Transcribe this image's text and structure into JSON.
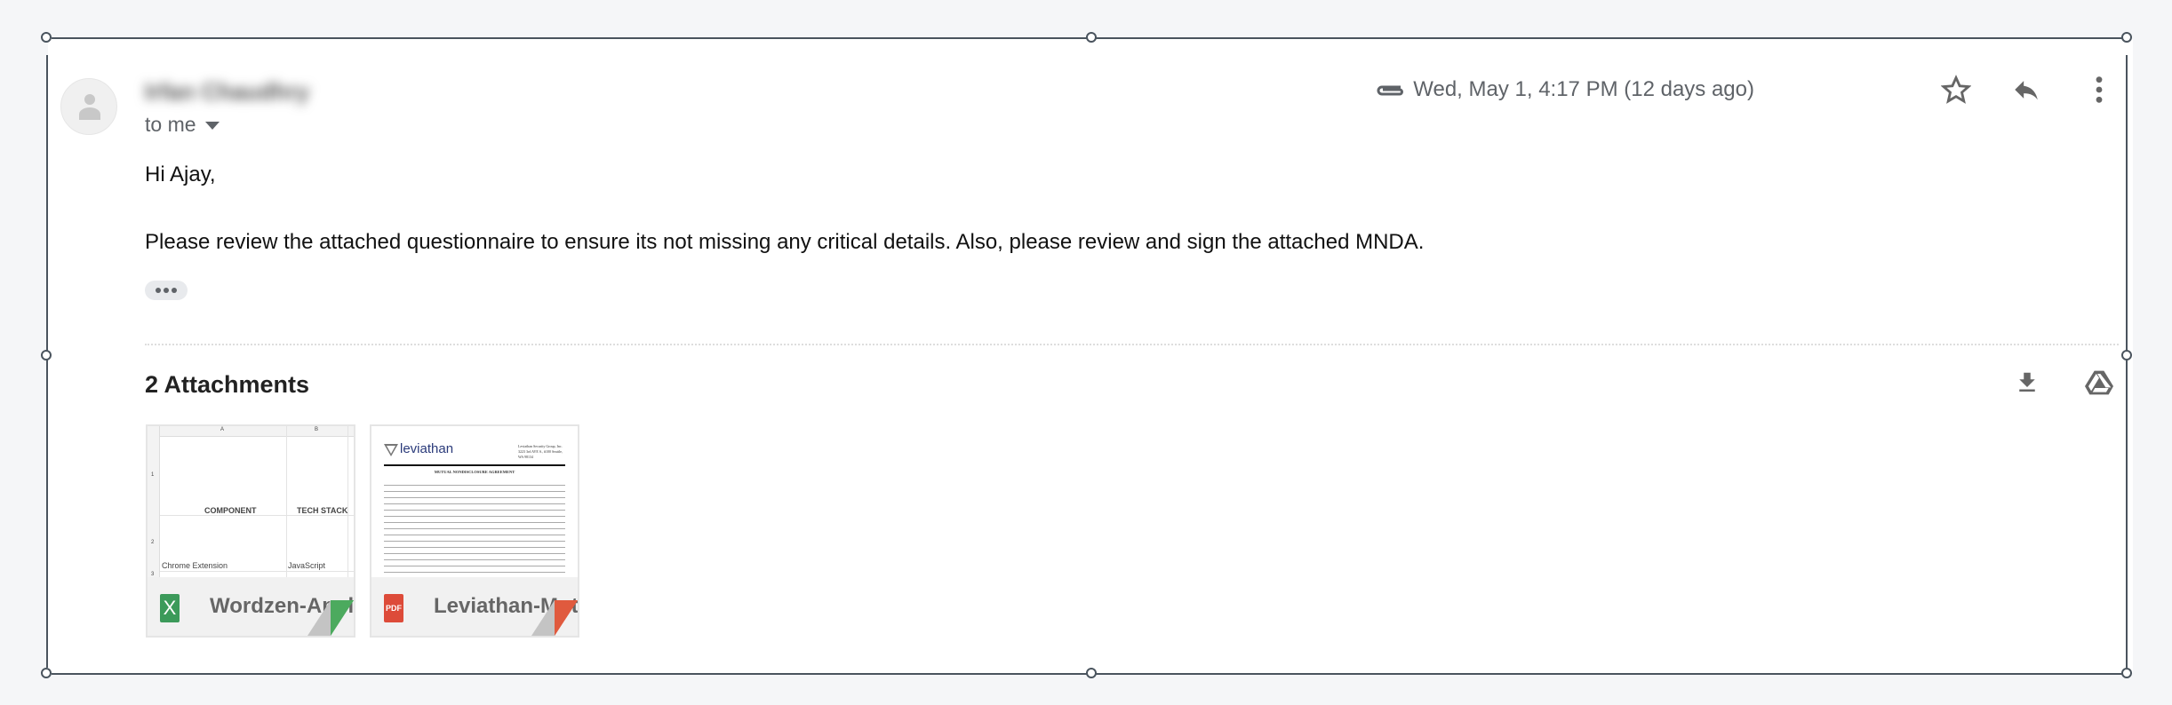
{
  "email": {
    "sender": "Irfan Chaudhry",
    "recipient_label": "to me",
    "timestamp": "Wed, May 1, 4:17 PM (12 days ago)",
    "greeting": "Hi Ajay,",
    "body": "Please review the attached questionnaire to ensure its not missing any critical details. Also, please review and sign the attached MNDA.",
    "icons": [
      "attachment-icon",
      "star-icon",
      "reply-icon",
      "more-vert-icon",
      "download-icon",
      "drive-icon"
    ]
  },
  "attachments": {
    "title": "2 Attachments",
    "items": [
      {
        "type": "X",
        "name": "Wordzen-Applicati...",
        "color": "#3c9a5a",
        "preview": {
          "col_a": "A",
          "col_b": "B",
          "h1": "COMPONENT",
          "h2": "TECH STACK",
          "r1": "Chrome Extension",
          "r2": "JavaScript",
          "rows": [
            "1",
            "2",
            "3"
          ]
        }
      },
      {
        "type": "PDF",
        "name": "Leviathan-Mutual-...",
        "color": "#dd4b39",
        "preview": {
          "logo": "leviathan",
          "address": "Leviathan Security Group, Inc. 3223 3rd AVE S., #100 Seattle, WA 98134",
          "heading": "MUTUAL NONDISCLOSURE AGREEMENT"
        }
      }
    ]
  }
}
